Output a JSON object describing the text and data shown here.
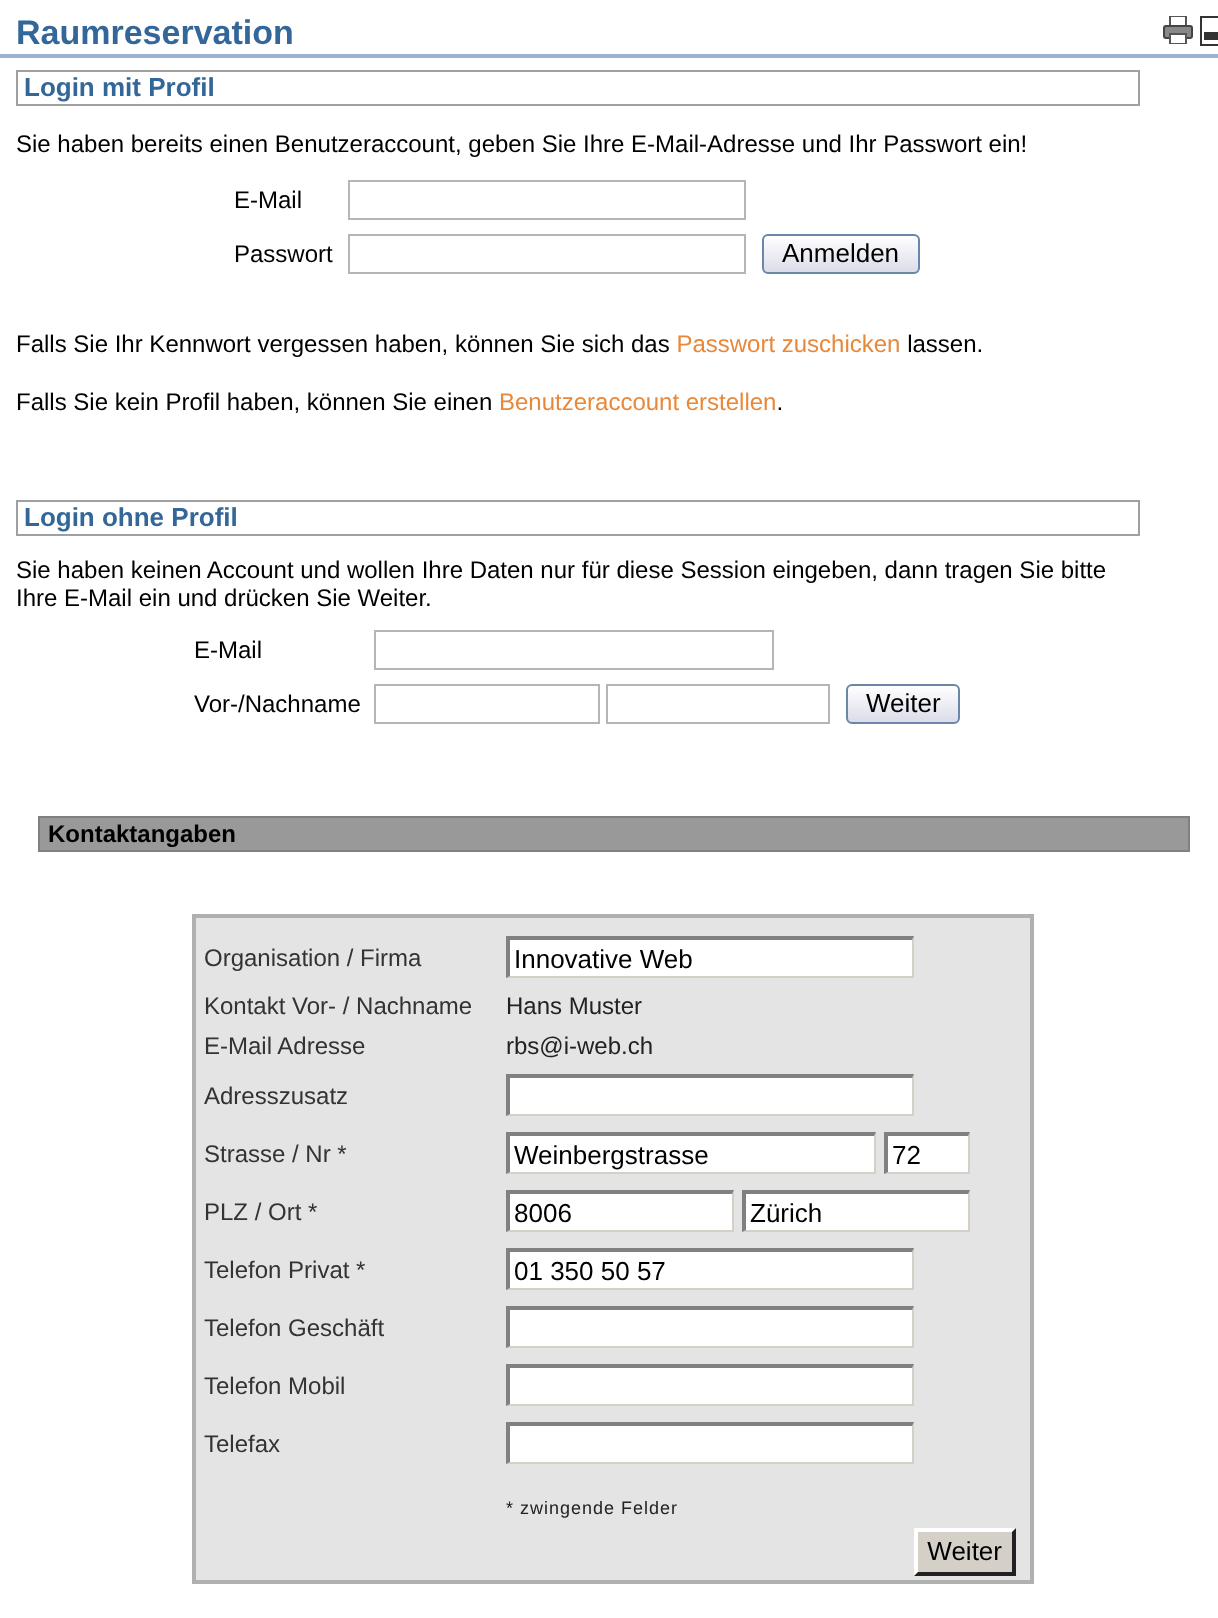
{
  "title": "Raumreservation",
  "login_profile": {
    "heading": "Login mit Profil",
    "intro": "Sie haben bereits einen Benutzeraccount, geben Sie Ihre E-Mail-Adresse und Ihr Passwort ein!",
    "email_label": "E-Mail",
    "password_label": "Passwort",
    "button": "Anmelden",
    "forgot": {
      "before": "Falls Sie Ihr Kennwort vergessen haben, können Sie sich das ",
      "link": "Passwort zuschicken",
      "after": " lassen."
    },
    "register": {
      "before": "Falls Sie kein Profil haben, können Sie einen ",
      "link": "Benutzeraccount erstellen",
      "after": "."
    }
  },
  "login_guest": {
    "heading": "Login ohne Profil",
    "intro": "Sie haben keinen Account und wollen Ihre Daten nur für diese Session eingeben, dann tragen Sie bitte Ihre E-Mail ein und drücken Sie Weiter.",
    "email_label": "E-Mail",
    "name_label": "Vor-/Nachname",
    "button": "Weiter"
  },
  "contact": {
    "heading": "Kontaktangaben",
    "rows": [
      {
        "label": "Organisation / Firma",
        "kind": "field",
        "values": [
          "Innovative Web"
        ]
      },
      {
        "label": "Kontakt Vor- / Nachname",
        "kind": "text",
        "text": "Hans Muster"
      },
      {
        "label": "E-Mail Adresse",
        "kind": "text",
        "text": "rbs@i-web.ch"
      },
      {
        "label": "Adresszusatz",
        "kind": "field"
      },
      {
        "label": "Strasse / Nr *",
        "kind": "street",
        "values": [
          "Weinbergstrasse",
          "72"
        ]
      },
      {
        "label": "PLZ / Ort *",
        "kind": "split",
        "values": [
          "8006",
          "Zürich"
        ]
      },
      {
        "label": "Telefon Privat *",
        "kind": "field",
        "values": [
          "01 350 50 57"
        ]
      },
      {
        "label": "Telefon Geschäft",
        "kind": "field"
      },
      {
        "label": "Telefon Mobil",
        "kind": "field"
      },
      {
        "label": "Telefax",
        "kind": "field"
      }
    ],
    "note": "* zwingende Felder",
    "button": "Weiter"
  }
}
